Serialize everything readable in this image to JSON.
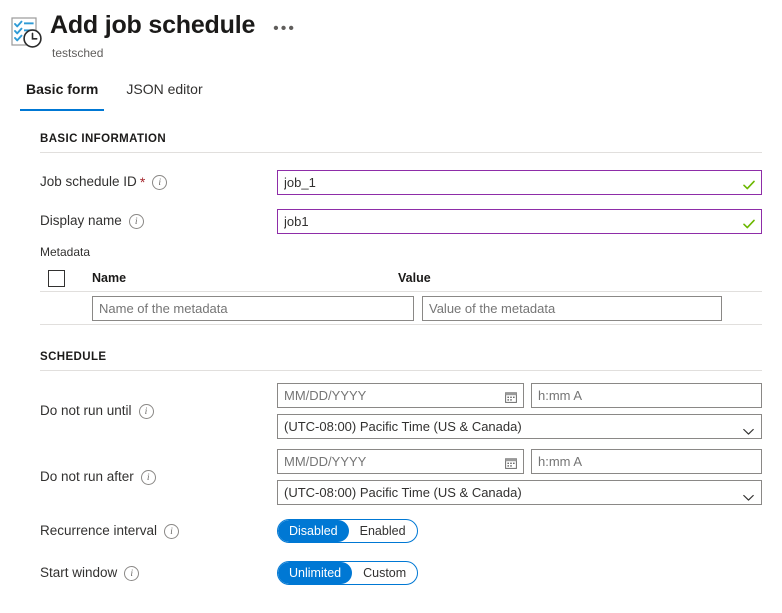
{
  "header": {
    "title": "Add job schedule",
    "subtitle": "testsched",
    "ellipsis": "•••",
    "icon": "job-schedule-icon"
  },
  "tabs": [
    {
      "label": "Basic form",
      "active": true
    },
    {
      "label": "JSON editor",
      "active": false
    }
  ],
  "sections": {
    "basic_information": {
      "header": "BASIC INFORMATION",
      "job_schedule_id": {
        "label": "Job schedule ID",
        "required_marker": "*",
        "value": "job_1",
        "valid": true
      },
      "display_name": {
        "label": "Display name",
        "value": "job1",
        "valid": true
      },
      "metadata": {
        "label": "Metadata",
        "columns": [
          "Name",
          "Value"
        ],
        "rows": [
          {
            "name_placeholder": "Name of the metadata",
            "name_value": "",
            "value_placeholder": "Value of the metadata",
            "value_value": ""
          }
        ]
      }
    },
    "schedule": {
      "header": "SCHEDULE",
      "do_not_run_until": {
        "label": "Do not run until",
        "date_placeholder": "MM/DD/YYYY",
        "date_value": "",
        "time_placeholder": "h:mm A",
        "time_value": "",
        "timezone": "(UTC-08:00) Pacific Time (US & Canada)"
      },
      "do_not_run_after": {
        "label": "Do not run after",
        "date_placeholder": "MM/DD/YYYY",
        "date_value": "",
        "time_placeholder": "h:mm A",
        "time_value": "",
        "timezone": "(UTC-08:00) Pacific Time (US & Canada)"
      },
      "recurrence_interval": {
        "label": "Recurrence interval",
        "options": [
          "Disabled",
          "Enabled"
        ],
        "selected": "Disabled"
      },
      "start_window": {
        "label": "Start window",
        "options": [
          "Unlimited",
          "Custom"
        ],
        "selected": "Unlimited"
      }
    }
  },
  "colors": {
    "accent": "#0078d4",
    "validated_border": "#8e2da8",
    "valid_check": "#6bb700",
    "required": "#a4262c",
    "divider": "#e1dfdd",
    "input_border": "#8a8886",
    "text": "#323130",
    "muted_text": "#605e5c"
  },
  "icons": {
    "info": "info-icon",
    "calendar": "calendar-icon",
    "chevron_down": "chevron-down-icon",
    "check": "check-icon"
  }
}
